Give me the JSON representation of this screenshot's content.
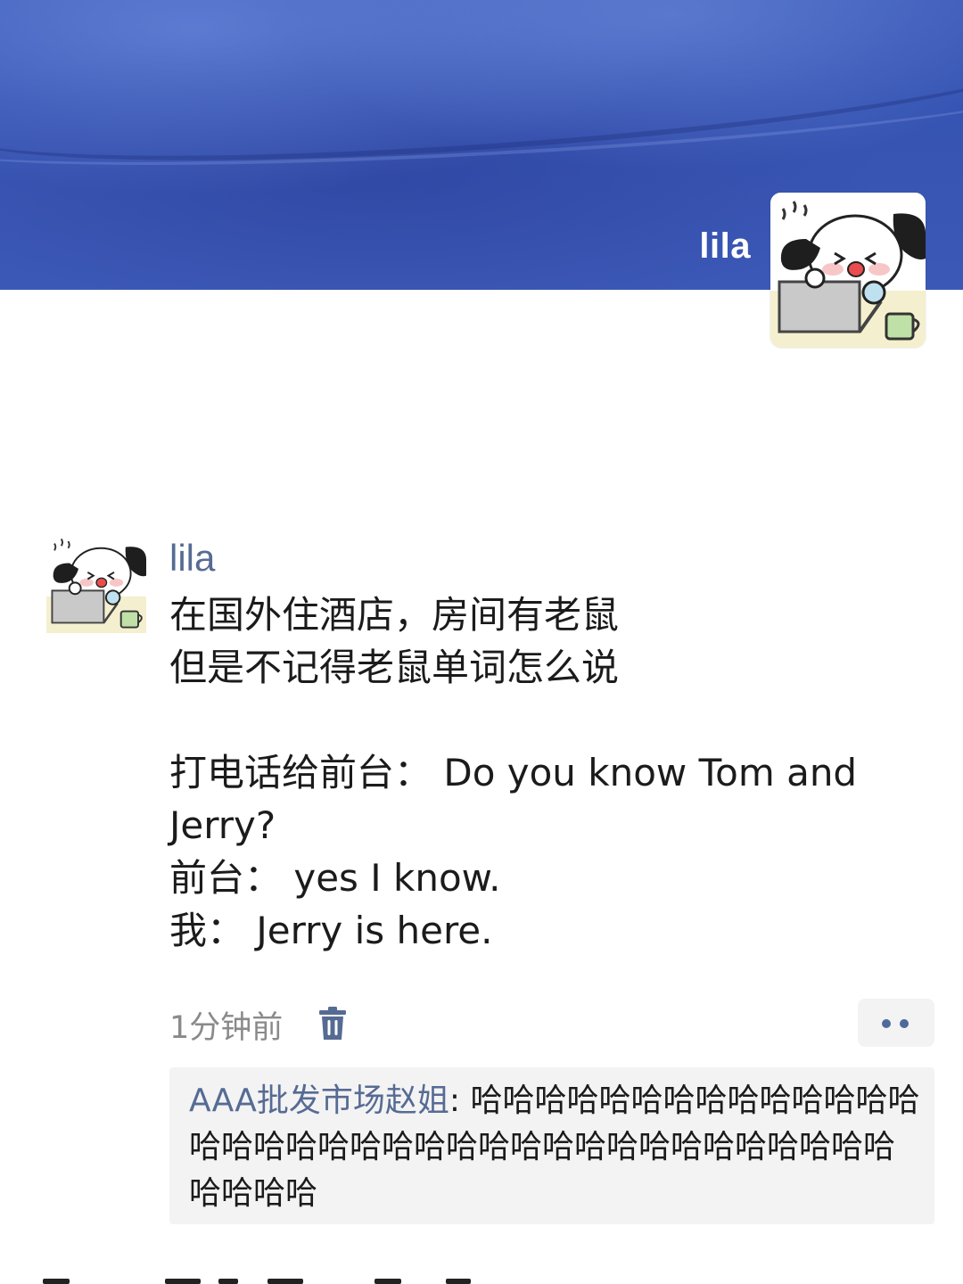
{
  "cover": {
    "name": "lila"
  },
  "post": {
    "author": "lila",
    "lines": [
      "在国外住酒店，房间有老鼠",
      "但是不记得老鼠单词怎么说",
      "",
      "打电话给前台： Do you know Tom and",
      "Jerry?",
      "前台： yes I know.",
      "我： Jerry is here."
    ],
    "time": "1分钟前"
  },
  "comments": [
    {
      "author": "AAA批发市场赵姐",
      "separator": ": ",
      "text": "哈哈哈哈哈哈哈哈哈哈哈哈哈哈哈哈哈哈哈哈哈哈哈哈哈哈哈哈哈哈哈哈哈哈哈哈哈哈哈哈"
    }
  ],
  "icons": {
    "delete": "trash-icon",
    "more": "more-dots-icon"
  },
  "colors": {
    "cover_blue": "#3553b2",
    "author_link": "#566b94",
    "meta_gray": "#8a8a8a",
    "panel_bg": "#f3f3f3"
  }
}
